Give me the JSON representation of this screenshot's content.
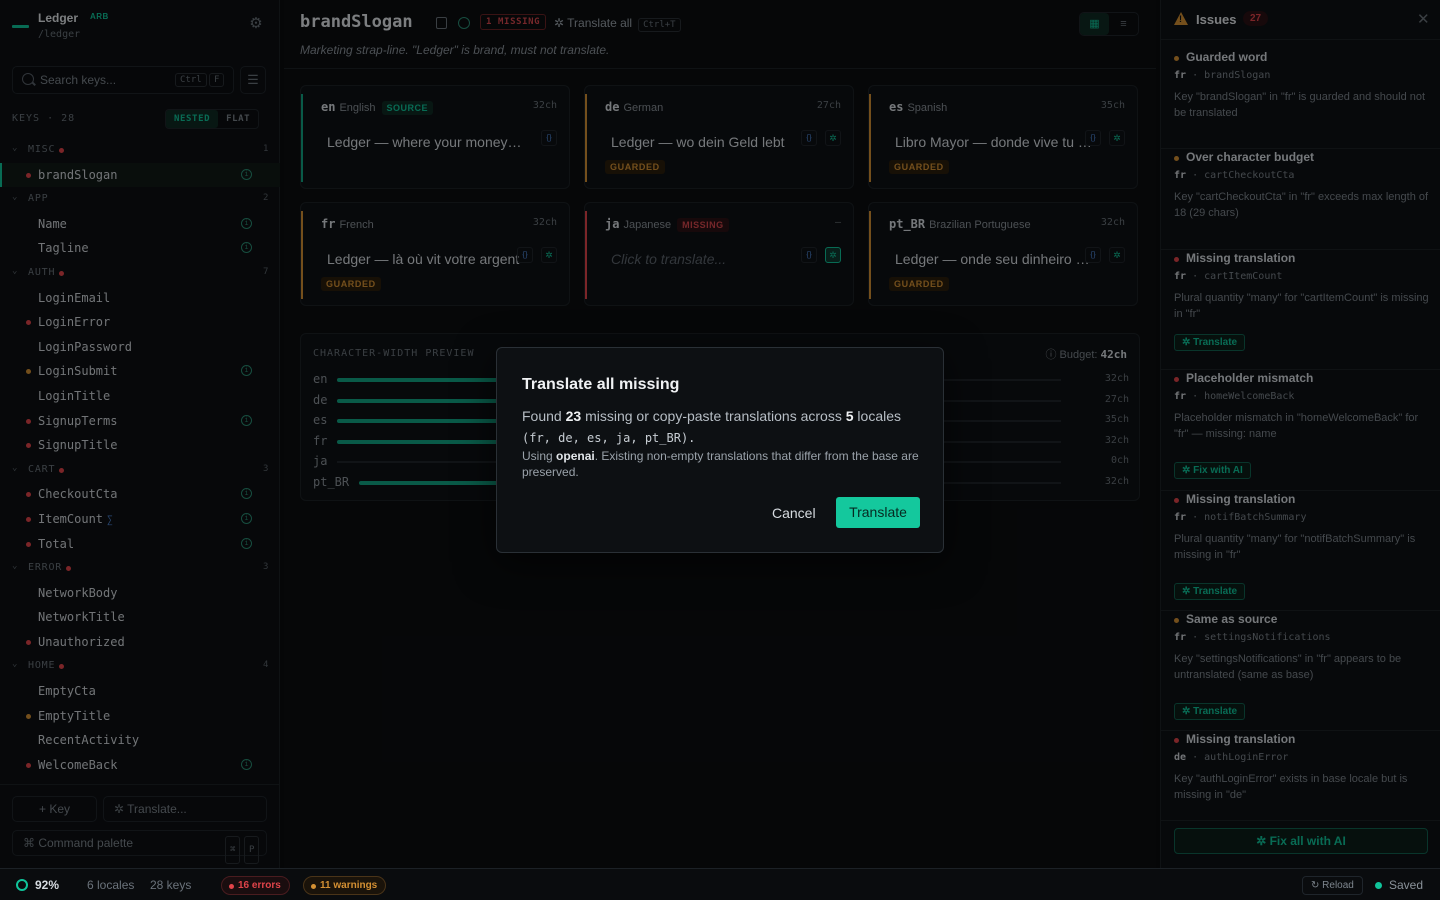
{
  "app": {
    "name": "Ledger",
    "badge": "ARB",
    "path": "/ledger"
  },
  "sidebar": {
    "search_placeholder": "Search keys...",
    "search_kbd": [
      "Ctrl",
      "F"
    ],
    "keys_label": "KEYS · 28",
    "view_modes": [
      "NESTED",
      "FLAT"
    ],
    "active_view": "NESTED",
    "add_key_label": "+ Key",
    "translate_label": "Translate...",
    "command_palette_label": "Command palette",
    "command_kbd": [
      "⌘",
      "P"
    ],
    "groups": [
      {
        "name": "MISC",
        "count": "1",
        "error": true,
        "keys": [
          {
            "name": "brandSlogan",
            "status": "error",
            "info": true,
            "selected": true
          }
        ]
      },
      {
        "name": "APP",
        "count": "2",
        "error": false,
        "keys": [
          {
            "name": "Name",
            "status": "none",
            "info": true
          },
          {
            "name": "Tagline",
            "status": "none",
            "info": true
          }
        ]
      },
      {
        "name": "AUTH",
        "count": "7",
        "error": true,
        "keys": [
          {
            "name": "LoginEmail",
            "status": "none",
            "info": false
          },
          {
            "name": "LoginError",
            "status": "error",
            "info": false
          },
          {
            "name": "LoginPassword",
            "status": "none",
            "info": false
          },
          {
            "name": "LoginSubmit",
            "status": "warning",
            "info": true
          },
          {
            "name": "LoginTitle",
            "status": "none",
            "info": false
          },
          {
            "name": "SignupTerms",
            "status": "error",
            "info": true
          },
          {
            "name": "SignupTitle",
            "status": "error",
            "info": false
          }
        ]
      },
      {
        "name": "CART",
        "count": "3",
        "error": true,
        "keys": [
          {
            "name": "CheckoutCta",
            "status": "error",
            "info": true
          },
          {
            "name": "ItemCount",
            "status": "error",
            "info": true,
            "plural": "∑"
          },
          {
            "name": "Total",
            "status": "error",
            "info": true
          }
        ]
      },
      {
        "name": "ERROR",
        "count": "3",
        "error": true,
        "keys": [
          {
            "name": "NetworkBody",
            "status": "none",
            "info": false
          },
          {
            "name": "NetworkTitle",
            "status": "none",
            "info": false
          },
          {
            "name": "Unauthorized",
            "status": "error",
            "info": false
          }
        ]
      },
      {
        "name": "HOME",
        "count": "4",
        "error": true,
        "keys": [
          {
            "name": "EmptyCta",
            "status": "none",
            "info": false
          },
          {
            "name": "EmptyTitle",
            "status": "warning",
            "info": false
          },
          {
            "name": "RecentActivity",
            "status": "none",
            "info": false
          },
          {
            "name": "WelcomeBack",
            "status": "error",
            "info": true
          }
        ]
      }
    ]
  },
  "main": {
    "key_title": "brandSlogan",
    "missing_badge": "1 MISSING",
    "translate_all_label": "Translate all",
    "translate_all_kbd": "Ctrl+T",
    "description": "Marketing strap-line. \"Ledger\" is brand, must not translate.",
    "locales": [
      {
        "code": "en",
        "name": "English",
        "chip": "SOURCE",
        "chip_kind": "src",
        "len": "32ch",
        "value": "Ledger — where your money lives",
        "guarded": "",
        "bar": "#12a584",
        "ai": false
      },
      {
        "code": "de",
        "name": "German",
        "chip": "",
        "chip_kind": "",
        "len": "27ch",
        "value": "Ledger — wo dein Geld lebt",
        "guarded": "GUARDED",
        "bar": "#d49033",
        "ai": true
      },
      {
        "code": "es",
        "name": "Spanish",
        "chip": "",
        "chip_kind": "",
        "len": "35ch",
        "value": "Libro Mayor — donde vive tu dinero",
        "guarded": "GUARDED",
        "bar": "#d49033",
        "ai": true
      },
      {
        "code": "fr",
        "name": "French",
        "chip": "",
        "chip_kind": "",
        "len": "32ch",
        "value": "Ledger — là où vit votre argent",
        "guarded": "GUARDED",
        "bar": "#d49033",
        "ai": true
      },
      {
        "code": "ja",
        "name": "Japanese",
        "chip": "MISSING",
        "chip_kind": "miss",
        "len": "–",
        "value": "",
        "placeholder": "Click to translate...",
        "guarded": "",
        "bar": "#e0444a",
        "ai": true,
        "ai_active": true
      },
      {
        "code": "pt_BR",
        "name": "Brazilian Portuguese",
        "chip": "",
        "chip_kind": "",
        "len": "32ch",
        "value": "Ledger — onde seu dinheiro vive",
        "guarded": "GUARDED",
        "bar": "#d49033",
        "ai": true
      }
    ],
    "preview": {
      "title": "CHARACTER-WIDTH PREVIEW",
      "budget_label": "Budget:",
      "budget": "42ch",
      "rows": [
        {
          "code": "en",
          "chars": 32,
          "label": "32ch"
        },
        {
          "code": "de",
          "chars": 27,
          "label": "27ch"
        },
        {
          "code": "es",
          "chars": 35,
          "label": "35ch"
        },
        {
          "code": "fr",
          "chars": 32,
          "label": "32ch"
        },
        {
          "code": "ja",
          "chars": 0,
          "label": "0ch"
        },
        {
          "code": "pt_BR",
          "chars": 32,
          "label": "32ch"
        }
      ]
    }
  },
  "issues": {
    "title": "Issues",
    "count": "27",
    "items": [
      {
        "severity": "warning",
        "title": "Guarded word",
        "locale": "fr",
        "key": "brandSlogan",
        "description": "Key \"brandSlogan\" in \"fr\" is guarded and should not be translated",
        "action": ""
      },
      {
        "severity": "warning",
        "title": "Over character budget",
        "locale": "fr",
        "key": "cartCheckoutCta",
        "description": "Key \"cartCheckoutCta\" in \"fr\" exceeds max length of 18 (29 chars)",
        "action": ""
      },
      {
        "severity": "error",
        "title": "Missing translation",
        "locale": "fr",
        "key": "cartItemCount",
        "description": "Plural quantity \"many\" for \"cartItemCount\" is missing in \"fr\"",
        "action": "Translate"
      },
      {
        "severity": "error",
        "title": "Placeholder mismatch",
        "locale": "fr",
        "key": "homeWelcomeBack",
        "description": "Placeholder mismatch in \"homeWelcomeBack\" for \"fr\" — missing: name",
        "action": "Fix with AI"
      },
      {
        "severity": "error",
        "title": "Missing translation",
        "locale": "fr",
        "key": "notifBatchSummary",
        "description": "Plural quantity \"many\" for \"notifBatchSummary\" is missing in \"fr\"",
        "action": "Translate"
      },
      {
        "severity": "warning",
        "title": "Same as source",
        "locale": "fr",
        "key": "settingsNotifications",
        "description": "Key \"settingsNotifications\" in \"fr\" appears to be untranslated (same as base)",
        "action": "Translate"
      },
      {
        "severity": "error",
        "title": "Missing translation",
        "locale": "de",
        "key": "authLoginError",
        "description": "Key \"authLoginError\" exists in base locale but is missing in \"de\"",
        "action": ""
      }
    ],
    "fix_all_label": "Fix all with AI"
  },
  "status": {
    "coverage": "92%",
    "locales": "6 locales",
    "keys": "28 keys",
    "errors": "16 errors",
    "warnings": "11 warnings",
    "reload": "Reload",
    "saved": "Saved"
  },
  "modal": {
    "title": "Translate all missing",
    "found_prefix": "Found",
    "found_count": "23",
    "found_middle": "missing or copy-paste translations across",
    "locale_count": "5",
    "found_suffix": "locales",
    "locale_list": "(fr, de, es, ja, pt_BR).",
    "using_prefix": "Using",
    "provider": "openai",
    "using_suffix": ". Existing non-empty translations that differ from the base are preserved.",
    "cancel_label": "Cancel",
    "confirm_label": "Translate"
  },
  "colors": {
    "accent": "#10c49a",
    "error": "#e0444a",
    "warning": "#d49033",
    "plural": "#4d86d6"
  }
}
